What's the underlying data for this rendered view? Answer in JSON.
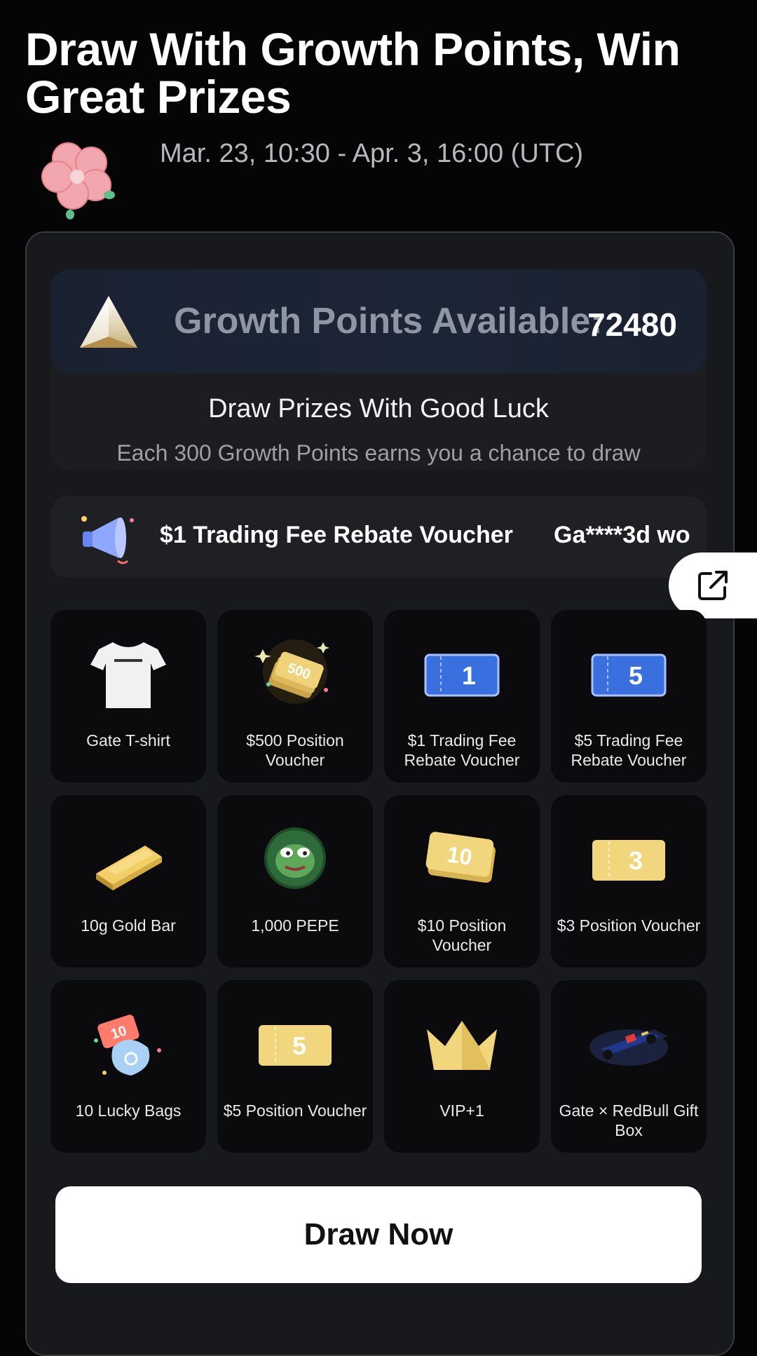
{
  "page": {
    "title": "Draw With Growth Points, Win Great Prizes",
    "date_range": "Mar. 23, 10:30 - Apr. 3, 16:00 (UTC)"
  },
  "points": {
    "label": "Growth Points Available:",
    "value": "72480",
    "draw_heading": "Draw Prizes With Good Luck",
    "draw_desc": "Each 300 Growth Points earns you a chance to draw"
  },
  "marquee": {
    "item1": "$1 Trading Fee Rebate Voucher",
    "item2": "Ga****3d wo"
  },
  "prizes": [
    {
      "label": "Gate T-shirt"
    },
    {
      "label": "$500 Position Voucher",
      "badge": "500"
    },
    {
      "label": "$1 Trading Fee Rebate Voucher",
      "badge": "1"
    },
    {
      "label": "$5 Trading Fee Rebate Voucher",
      "badge": "5"
    },
    {
      "label": "10g Gold Bar"
    },
    {
      "label": "1,000 PEPE"
    },
    {
      "label": "$10 Position Voucher",
      "badge": "10"
    },
    {
      "label": "$3 Position Voucher",
      "badge": "3"
    },
    {
      "label": "10 Lucky Bags",
      "badge": "10"
    },
    {
      "label": "$5 Position Voucher",
      "badge": "5"
    },
    {
      "label": "VIP+1"
    },
    {
      "label": "Gate × RedBull Gift Box"
    }
  ],
  "actions": {
    "draw_now": "Draw Now"
  },
  "colors": {
    "background": "#050506",
    "panel": "#18191c",
    "accent_blue": "#3a6fe0",
    "gold": "#e8c760"
  }
}
